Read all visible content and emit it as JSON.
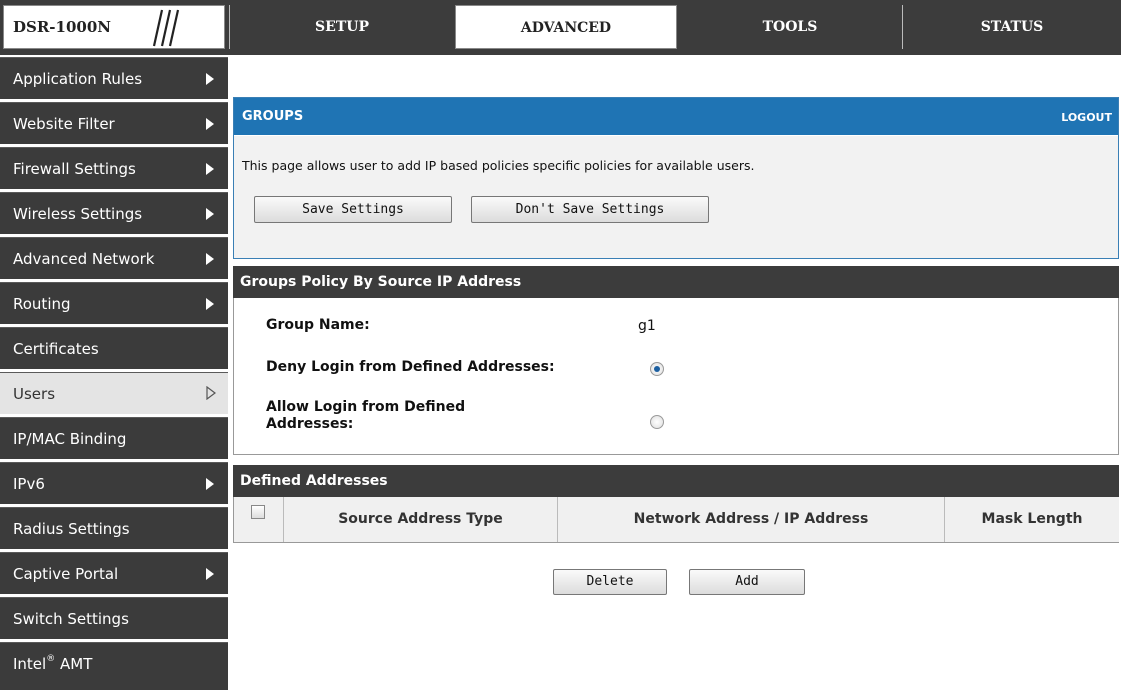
{
  "header": {
    "logo_text": "DSR-1000N",
    "tabs": [
      {
        "label": "SETUP"
      },
      {
        "label": "ADVANCED"
      },
      {
        "label": "TOOLS"
      },
      {
        "label": "STATUS"
      }
    ]
  },
  "sidebar": {
    "items": [
      {
        "label": "Application Rules"
      },
      {
        "label": "Website Filter"
      },
      {
        "label": "Firewall Settings"
      },
      {
        "label": "Wireless Settings"
      },
      {
        "label": "Advanced Network"
      },
      {
        "label": "Routing"
      },
      {
        "label": "Certificates"
      },
      {
        "label": "Users"
      },
      {
        "label": "IP/MAC Binding"
      },
      {
        "label": "IPv6"
      },
      {
        "label": "Radius Settings"
      },
      {
        "label": "Captive Portal"
      },
      {
        "label": "Switch Settings"
      },
      {
        "label": "Intel",
        "sup": "®",
        "suffix": " AMT"
      }
    ]
  },
  "groups": {
    "title": "GROUPS",
    "logout": "LOGOUT",
    "description": "This page allows user to add IP based policies specific policies for available users.",
    "save_label": "Save Settings",
    "dont_save_label": "Don't Save Settings"
  },
  "policy": {
    "title": "Groups Policy By Source IP Address",
    "group_name_label": "Group Name:",
    "group_name_value": "g1",
    "deny_label": "Deny Login from Defined Addresses:",
    "allow_label_line1": "Allow Login from Defined",
    "allow_label_line2": "Addresses:",
    "selected": "deny"
  },
  "addresses": {
    "title": "Defined Addresses",
    "columns": [
      "Source Address Type",
      "Network Address / IP Address",
      "Mask Length"
    ],
    "delete_label": "Delete",
    "add_label": "Add"
  }
}
